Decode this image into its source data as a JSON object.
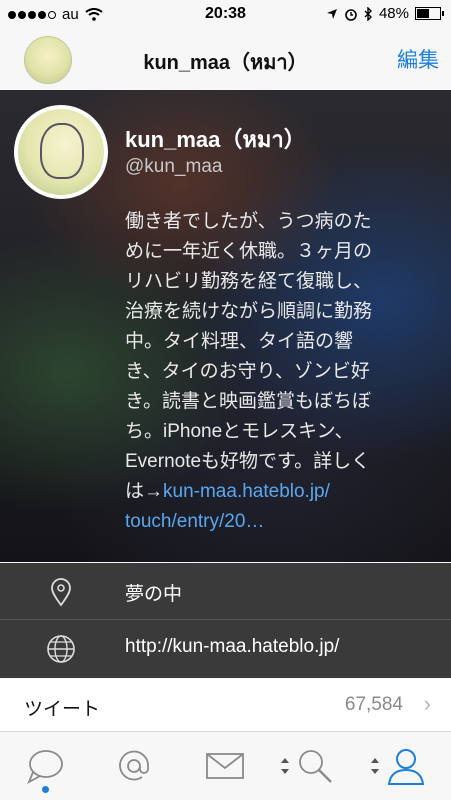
{
  "status": {
    "carrier": "au",
    "time": "20:38",
    "battery": "48%"
  },
  "nav": {
    "title": "kun_maa（หมา）",
    "edit": "編集"
  },
  "profile": {
    "name": "kun_maa（หมา）",
    "handle": "@kun_maa",
    "bio_lines": [
      "働き者でしたが、うつ病のた",
      "めに一年近く休職。３ヶ月の",
      "リハビリ勤務を経て復職し、",
      "治療を続けながら順調に勤務",
      "中。タイ料理、タイ語の響",
      "き、タイのお守り、ゾンビ好",
      "き。読書と映画鑑賞もぼちぼ",
      "ち。iPhoneとモレスキン、",
      "Evernoteも好物です。詳しく"
    ],
    "bio_link_prefix": "は→",
    "bio_link_1": "kun-maa.hateblo.jp/",
    "bio_link_2": "touch/entry/20…"
  },
  "info": {
    "location": "夢の中",
    "website": "http://kun-maa.hateblo.jp/"
  },
  "tweets": {
    "label": "ツイート",
    "count": "67,584"
  },
  "colors": {
    "accent": "#1d7fd8",
    "link": "#5aa7ef"
  },
  "tabs": [
    "chat-bubble-icon",
    "at-icon",
    "envelope-icon",
    "search-icon",
    "profile-icon"
  ]
}
